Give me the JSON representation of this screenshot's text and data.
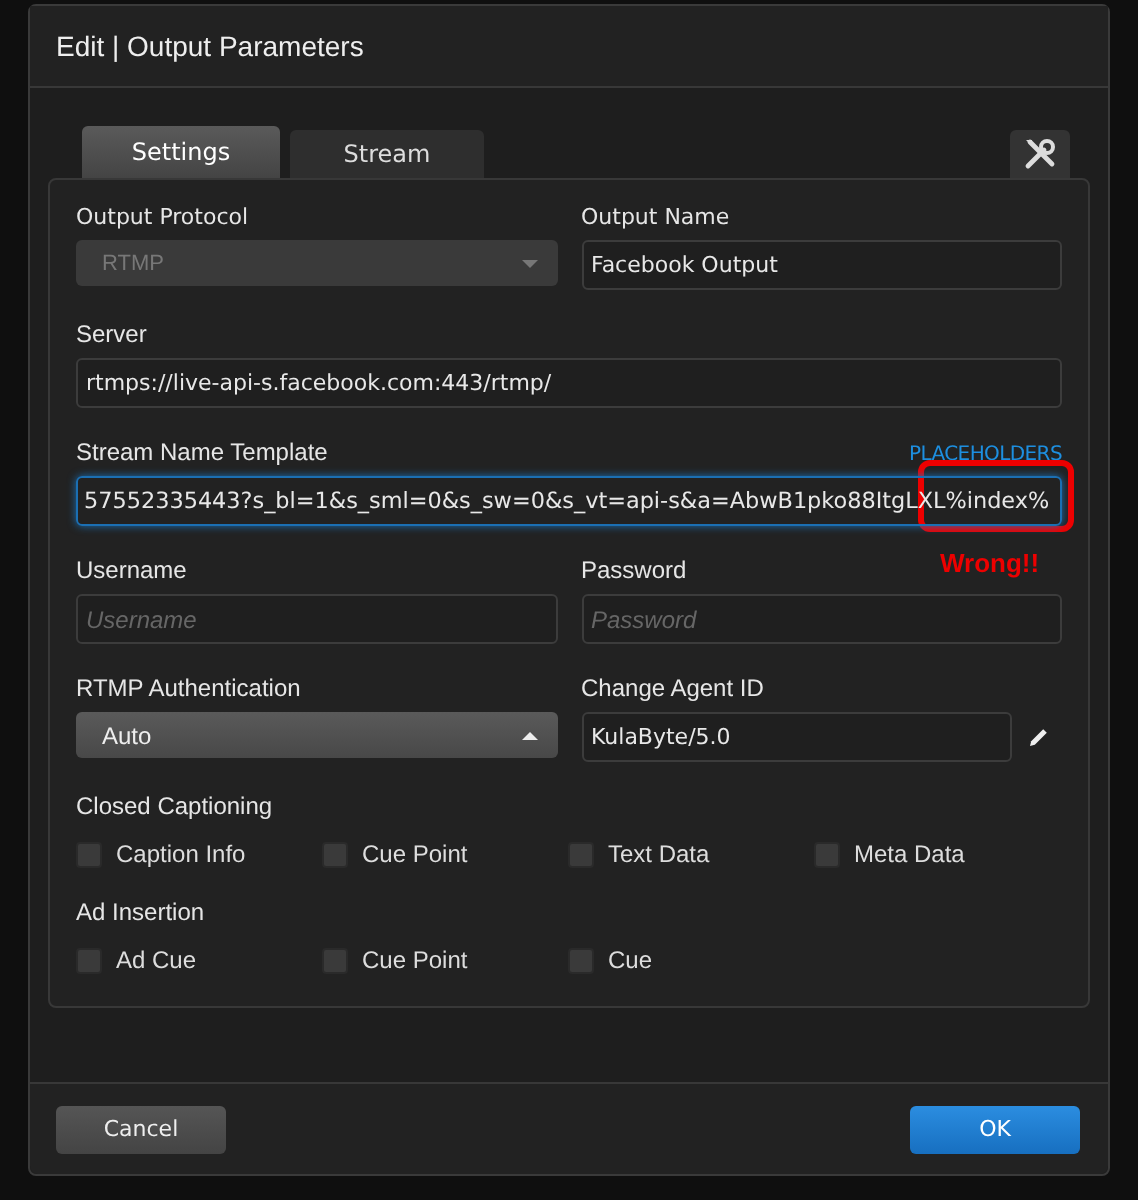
{
  "dialog": {
    "title": "Edit | Output Parameters"
  },
  "tabs": [
    {
      "label": "Settings",
      "selected": true
    },
    {
      "label": "Stream",
      "selected": false
    }
  ],
  "rows": [
    {
      "fields": [
        {
          "kind": "select",
          "label": "Output Protocol",
          "value": "RTMP",
          "disabled": true,
          "expanded": false
        },
        {
          "kind": "text",
          "label": "Output Name",
          "value": "Facebook Output"
        }
      ]
    },
    {
      "fields": [
        {
          "kind": "text",
          "label": "Server",
          "value": "rtmps://live-api-s.facebook.com:443/rtmp/"
        }
      ]
    },
    {
      "fields": [
        {
          "kind": "text",
          "label": "Stream Name Template",
          "link": "PLACEHOLDERS",
          "value": "57552335443?s_bl=1&s_sml=0&s_sw=0&s_vt=api-s&a=AbwB1pko88ItgLXL%index%",
          "focused": true
        }
      ]
    },
    {
      "fields": [
        {
          "kind": "text",
          "label": "Username",
          "placeholder": "Username"
        },
        {
          "kind": "text",
          "label": "Password",
          "placeholder": "Password"
        }
      ]
    },
    {
      "fields": [
        {
          "kind": "select",
          "label": "RTMP Authentication",
          "value": "Auto",
          "disabled": false,
          "expanded": true
        },
        {
          "kind": "text",
          "label": "Change Agent ID",
          "value": "KulaByte/5.0",
          "editable": true
        }
      ]
    }
  ],
  "groups": [
    {
      "title": "Closed Captioning",
      "options": [
        {
          "label": "Caption Info",
          "checked": false
        },
        {
          "label": "Cue Point",
          "checked": false
        },
        {
          "label": "Text Data",
          "checked": false
        },
        {
          "label": "Meta Data",
          "checked": false
        }
      ]
    },
    {
      "title": "Ad Insertion",
      "options": [
        {
          "label": "Ad Cue",
          "checked": false
        },
        {
          "label": "Cue Point",
          "checked": false
        },
        {
          "label": "Cue",
          "checked": false
        }
      ]
    }
  ],
  "annotation": {
    "label": "Wrong!!"
  },
  "buttons": [
    {
      "label": "Cancel",
      "kind": "secondary"
    },
    {
      "label": "OK",
      "kind": "primary"
    }
  ]
}
